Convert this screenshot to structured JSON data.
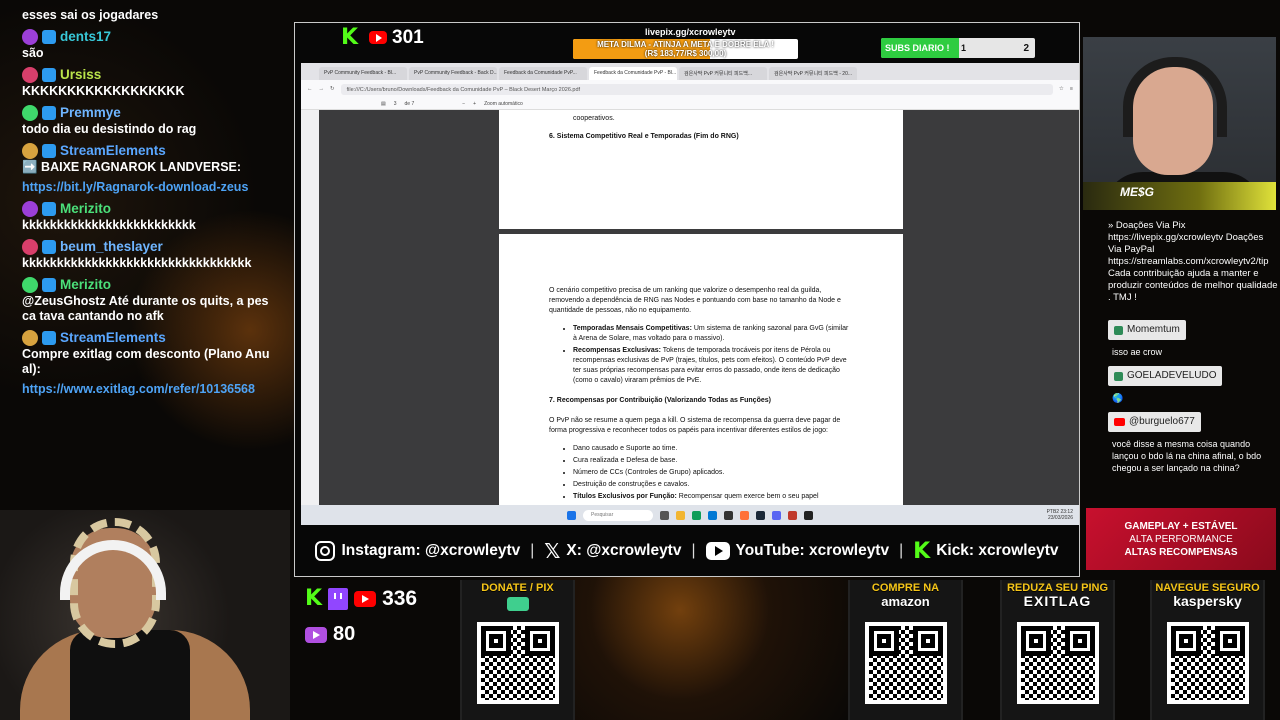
{
  "chat": {
    "messages": [
      {
        "user": "",
        "text": "esses sai os jogadares",
        "user_color": "#ffffff",
        "link": false
      },
      {
        "user": "dents17",
        "text": "são",
        "user_color": "#38c8d8",
        "link": false
      },
      {
        "user": "Ursiss",
        "text": "KKKKKKKKKKKKKKKKKK",
        "user_color": "#b9e34a",
        "link": false
      },
      {
        "user": "Premmye",
        "text": "todo dia eu desistindo do rag",
        "user_color": "#6fb5ff",
        "link": false
      },
      {
        "user": "StreamElements",
        "text": "➡️ BAIXE RAGNAROK LANDVERSE:",
        "user_color": "#5aa7ff",
        "link": false
      },
      {
        "user": "",
        "text": "https://bit.ly/Ragnarok-download-zeus",
        "user_color": "#4ea3f5",
        "link": true
      },
      {
        "user": "Merizito",
        "text": "kkkkkkkkkkkkkkkkkkkkkkkkk",
        "user_color": "#4be07a",
        "link": false
      },
      {
        "user": "beum_theslayer",
        "text": "kkkkkkkkkkkkkkkkkkkkkkkkkkkkkkkkk",
        "user_color": "#6fb5ff",
        "link": false
      },
      {
        "user": "Merizito",
        "text": "@ZeusGhostz Até durante os quits, a pesca tava cantando no afk",
        "user_color": "#4be07a",
        "link": false
      },
      {
        "user": "StreamElements",
        "text": "Compre exitlag com desconto (Plano Anual):",
        "user_color": "#5aa7ff",
        "link": false
      },
      {
        "user": "",
        "text": "https://www.exitlag.com/refer/10136568",
        "user_color": "#4ea3f5",
        "link": true
      }
    ]
  },
  "top": {
    "kick_count": "301",
    "goal_url": "livepix.gg/xcrowleytv",
    "goal_text_1": "META DILMA - ATINJA A META E DOBRE ELA !",
    "goal_text_2": "(R$ 183,77/R$ 300,00)",
    "goal_progress_pct": 61,
    "subs_label": "SUBS DIARIO !",
    "subs_current": "1",
    "subs_target": "2"
  },
  "browser": {
    "tabs": [
      "PvP Community Feedback - Bl...",
      "PvP Community Feedback - Back D...",
      "Feedback da Comunidade PvP...",
      "Feedback da Comunidade PvP - Bl...",
      "검은사막 PvP 커뮤니티 피드백...",
      "검은사막 PvP 커뮤니티 피드백 - 20..."
    ],
    "url": "file:///C:/Users/bruno/Downloads/Feedback da Comunidade PvP – Black Desert Março 2026.pdf",
    "page_num": "3",
    "page_of": "de 7",
    "zoom": "Zoom automático",
    "search_placeholder": "Pesquisar",
    "clock_1": "PTB2",
    "clock_2": "23:12",
    "clock_3": "23/03/2026"
  },
  "doc": {
    "p1_tail": "cooperativos.",
    "h6": "6. Sistema Competitivo Real e Temporadas (Fim do RNG)",
    "p6": "O cenário competitivo precisa de um ranking que valorize o desempenho real da guilda, removendo a dependência de RNG nas Nodes e pontuando com base no tamanho da Node e quantidade de pessoas, não no equipamento.",
    "b1_bold": "Temporadas Mensais Competitivas:",
    "b1_text": " Um sistema de ranking sazonal para GvG (similar à Arena de Solare, mas voltado para o massivo).",
    "b2_bold": "Recompensas Exclusivas:",
    "b2_text": " Tokens de temporada trocáveis por itens de Pérola ou recompensas exclusivas de PvP (trajes, títulos, pets com efeitos). O conteúdo PvP deve ter suas próprias recompensas para evitar erros do passado, onde itens de dedicação (como o cavalo) viraram prêmios de PvE.",
    "h7": "7. Recompensas por Contribuição (Valorizando Todas as Funções)",
    "p7": "O PvP não se resume a quem pega a kill. O sistema de recompensa da guerra deve pagar de forma progressiva e reconhecer todos os papéis para incentivar diferentes estilos de jogo:",
    "l1": "Dano causado e Suporte ao time.",
    "l2": "Cura realizada e Defesa de base.",
    "l3": "Número de CCs (Controles de Grupo) aplicados.",
    "l4": "Destruição de construções e cavalos.",
    "l5_bold": "Títulos Exclusivos por Função:",
    "l5_text": " Recompensar quem exerce bem o seu papel"
  },
  "socials": {
    "instagram": "Instagram: @xcrowleytv",
    "x": "X: @xcrowleytv",
    "youtube": "YouTube: xcrowleytv",
    "kick": "Kick: xcrowleytv",
    "x_glyph": "𝕏",
    "kick_glyph": "K"
  },
  "cam": {
    "logo_text": "ME$G"
  },
  "rpanel": {
    "info": "» Doações Via Pix https://livepix.gg/xcrowleytv Doações Via PayPal https://streamlabs.com/xcrowleytv2/tip Cada contribuição ajuda a manter e produzir conteúdos de melhor qualidade . TMJ !",
    "c1_user": "Momemtum",
    "c1_text": "isso ae crow",
    "c2_user": "GOELADEVELUDO",
    "c2_text": "🌎",
    "c3_user": "@burguelo677",
    "c3_text": "você disse a mesma coisa quando lançou o bdo lá na china afinal, o bdo chegou a ser lançado na china?",
    "promo_1": "GAMEPLAY + ESTÁVEL",
    "promo_2": "ALTA PERFORMANCE",
    "promo_3": "ALTAS RECOMPENSAS"
  },
  "stats": {
    "views_youtube": "336",
    "views_other": "80",
    "kick_glyph": "K"
  },
  "qr_cards": {
    "donate": {
      "title": "DONATE / PIX"
    },
    "amazon": {
      "title": "COMPRE NA",
      "sub": "amazon"
    },
    "exitlag": {
      "title": "REDUZA SEU PING",
      "sub": "EXITLAG"
    },
    "kaspersky": {
      "title": "NAVEGUE SEGURO",
      "sub": "kaspersky"
    }
  },
  "colors": {
    "kick_green": "#53fc18",
    "youtube_red": "#ff0000",
    "twitch_purple": "#9146ff",
    "goal_orange": "#f39c12",
    "subs_green": "#2ecc40",
    "link_blue": "#4ea3f5",
    "qr_title_yellow": "#f5c518"
  }
}
